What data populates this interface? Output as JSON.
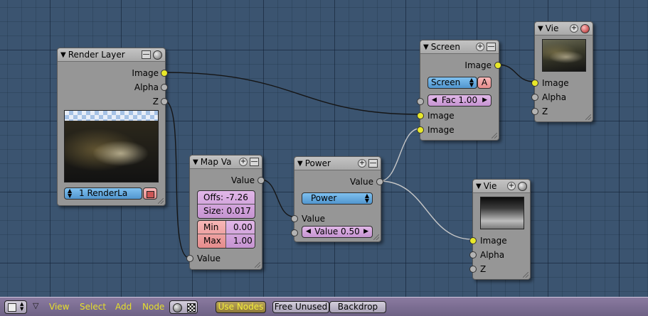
{
  "colors": {
    "background": "#3b5470",
    "node_body": "#969696",
    "socket_color": "#e8e82a",
    "socket_value": "#b3b3b3",
    "button_blue": "#5196cf",
    "button_purple": "#c694d1",
    "button_pink": "#e58c8c",
    "toolbar": "#7a6c92",
    "toolbar_text": "#e7e02a"
  },
  "nodes": {
    "render_layer": {
      "title": "Render Layer",
      "outputs": [
        "Image",
        "Alpha",
        "Z"
      ],
      "layer_label": "1 RenderLa"
    },
    "map_value": {
      "title": "Map Va",
      "output": "Value",
      "offs": "Offs: -7.26",
      "size": "Size: 0.017",
      "min_label": "Min",
      "min_value": "0.00",
      "max_label": "Max",
      "max_value": "1.00",
      "input": "Value"
    },
    "power": {
      "title": "Power",
      "output": "Value",
      "mode": "Power",
      "input": "Value",
      "value_field": "Value 0.50"
    },
    "screen": {
      "title": "Screen",
      "output": "Image",
      "mode": "Screen",
      "alpha_toggle": "A",
      "fac": "Fac 1.00",
      "inputs": [
        "Image",
        "Image"
      ]
    },
    "viewer_top": {
      "title": "Vie",
      "inputs": [
        "Image",
        "Alpha",
        "Z"
      ]
    },
    "viewer_bottom": {
      "title": "Vie",
      "inputs": [
        "Image",
        "Alpha",
        "Z"
      ]
    }
  },
  "toolbar": {
    "menus": [
      "View",
      "Select",
      "Add",
      "Node"
    ],
    "use_nodes": "Use Nodes",
    "free_unused": "Free Unused",
    "backdrop": "Backdrop"
  },
  "icons": {
    "editor_type": "node-editor-icon",
    "menu_toggle": "triangle-down-icon",
    "composite_toggle": "sphere-icon",
    "texture_toggle": "texture-icon"
  }
}
